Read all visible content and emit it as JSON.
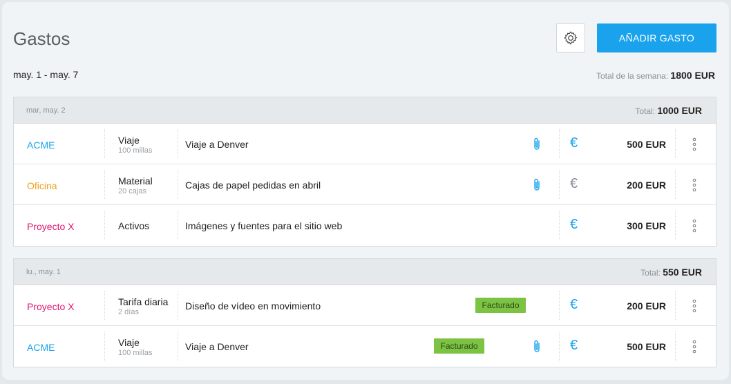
{
  "header": {
    "title": "Gastos",
    "add_button_label": "AÑADIR GASTO",
    "settings_icon": "gear-icon",
    "date_range": "may. 1 - may. 7",
    "week_total_label": "Total de la semana:",
    "week_total_value": "1800 EUR"
  },
  "colors": {
    "accent": "#1aa3ec",
    "acme": "#1aa3ec",
    "oficina": "#f0a01d",
    "proyecto_x": "#e0156f",
    "euro_active": "#1aa3ec",
    "euro_inactive": "#8a9097",
    "badge": "#7cc243"
  },
  "groups": [
    {
      "date": "mar, may. 2",
      "total_label": "Total:",
      "total_value": "1000 EUR",
      "rows": [
        {
          "client": "ACME",
          "category": "Viaje",
          "sub": "100 millas",
          "description": "Viaje a Denver",
          "badge": "",
          "attachment": true,
          "euro_active": true,
          "amount": "500 EUR"
        },
        {
          "client": "Oficina",
          "category": "Material",
          "sub": "20 cajas",
          "description": "Cajas de papel pedidas en abril",
          "badge": "",
          "attachment": true,
          "euro_active": false,
          "amount": "200 EUR"
        },
        {
          "client": "Proyecto X",
          "category": "Activos",
          "sub": "",
          "description": "Imágenes y fuentes para el sitio web",
          "badge": "",
          "attachment": false,
          "euro_active": true,
          "amount": "300 EUR"
        }
      ]
    },
    {
      "date": "lu., may. 1",
      "total_label": "Total:",
      "total_value": "550 EUR",
      "rows": [
        {
          "client": "Proyecto X",
          "category": "Tarifa diaria",
          "sub": "2 días",
          "description": "Diseño de vídeo en movimiento",
          "badge": "Facturado",
          "attachment": false,
          "euro_active": true,
          "amount": "200 EUR"
        },
        {
          "client": "ACME",
          "category": "Viaje",
          "sub": "100 millas",
          "description": "Viaje a Denver",
          "badge": "Facturado",
          "attachment": true,
          "euro_active": true,
          "amount": "500 EUR"
        }
      ]
    }
  ],
  "icons": {
    "euro_symbol": "€",
    "attachment": "paperclip-icon",
    "more": "more-vertical-icon"
  }
}
